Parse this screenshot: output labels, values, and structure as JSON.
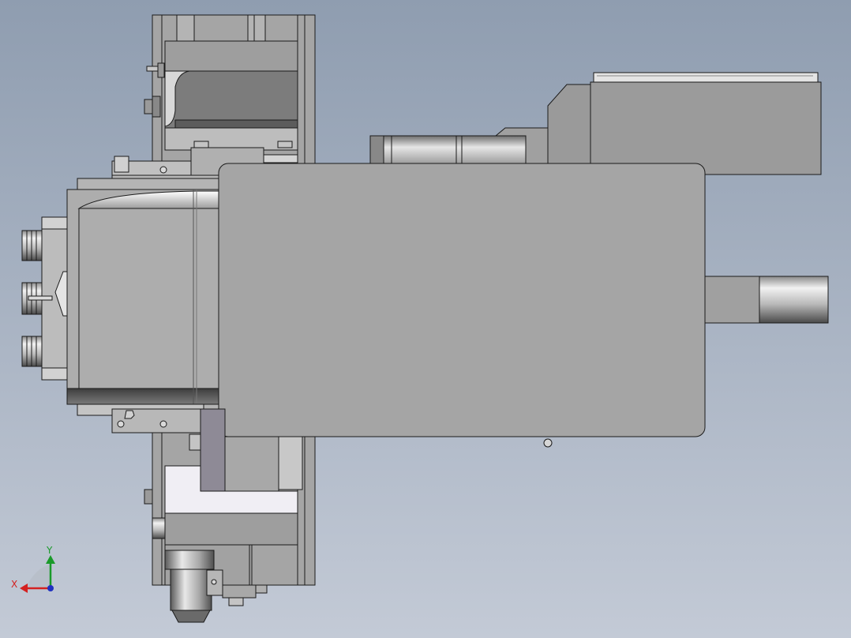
{
  "viewport": {
    "background_top": "#8f9db0",
    "background_bottom": "#c3cad6",
    "part_fill": "#a5a5a5",
    "part_edge": "#1a1a1a"
  },
  "triad": {
    "x_label": "X",
    "y_label": "Y",
    "x_color": "#d42020",
    "y_color": "#1a9a2a",
    "z_color": "#2030c0"
  }
}
